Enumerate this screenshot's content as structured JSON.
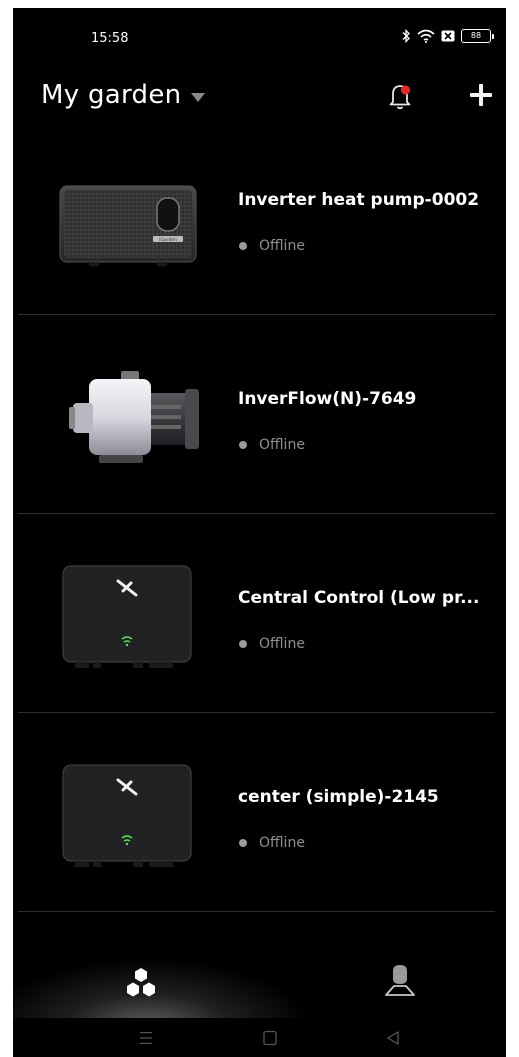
{
  "status_bar": {
    "time": "15:58",
    "battery_level": "88",
    "icons": [
      "bluetooth-icon",
      "wifi-icon",
      "sim-x-icon",
      "battery-icon"
    ]
  },
  "header": {
    "title": "My garden",
    "dropdown_icon": "caret-down-icon",
    "notification_icon": "bell-icon",
    "notification_badge_color": "#e02a2a",
    "add_icon": "plus-icon"
  },
  "devices": [
    {
      "name": "Inverter heat pump-0002",
      "status": "Offline",
      "image": "heat-pump-image",
      "brand_label": "iGarden"
    },
    {
      "name": "InverFlow(N)-7649",
      "status": "Offline",
      "image": "water-pump-image"
    },
    {
      "name": "Central Control (Low pr...",
      "status": "Offline",
      "image": "controller-image"
    },
    {
      "name": "center (simple)-2145",
      "status": "Offline",
      "image": "controller-image"
    }
  ],
  "tab_bar": {
    "tabs": [
      {
        "name": "devices",
        "icon": "devices-cluster-icon",
        "active": true
      },
      {
        "name": "profile",
        "icon": "user-icon",
        "active": false
      }
    ]
  },
  "system_nav": {
    "buttons": [
      "menu-icon",
      "home-square-icon",
      "back-triangle-icon"
    ]
  },
  "colors": {
    "background": "#000000",
    "text_primary": "#ffffff",
    "text_secondary": "#8f8f8f",
    "divider": "#2e2e2e",
    "wifi_green": "#5fdc5a"
  }
}
